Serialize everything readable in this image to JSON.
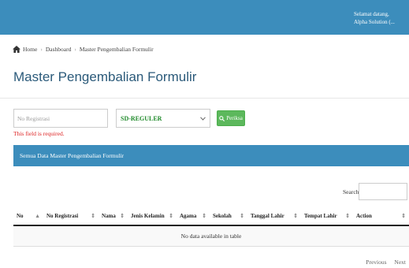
{
  "header": {
    "greeting_line1": "Selamat datang,",
    "greeting_line2": "Alpha Solution (...",
    "color": "#3c8dbc"
  },
  "breadcrumb": {
    "home": "Home",
    "dashboard": "Dashboard",
    "current": "Master Pengembalian Formulir",
    "home_icon": "home-icon"
  },
  "page": {
    "title": "Master Pengembalian Formulir"
  },
  "filter": {
    "reg_placeholder": "No Registrasi",
    "reg_value": "",
    "error": "This field is required.",
    "select_value": "SD-REGULER",
    "search_button": "Periksa",
    "search_icon": "search-icon",
    "button_color": "#5cb85c"
  },
  "panel": {
    "title": "Semua Data Master Pengembalian Formulir"
  },
  "table": {
    "search_label": "Search:",
    "columns": [
      "No",
      "No Registrasi",
      "Nama",
      "Jenis Kelamin",
      "Agama",
      "Sekolah",
      "Tanggal Lahir",
      "Tempat Lahir",
      "Action"
    ],
    "empty_text": "No data available in table"
  },
  "pager": {
    "previous": "Previous",
    "next": "Next"
  }
}
